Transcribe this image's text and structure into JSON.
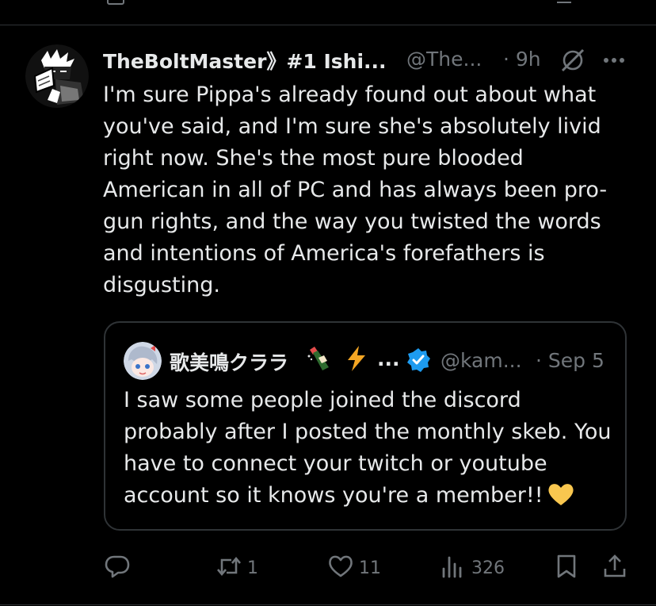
{
  "tweet": {
    "author_name": "TheBoltMaster》#1 Ishi...",
    "author_handle": "@The...",
    "time": "· 9h",
    "text": "I'm sure Pippa's already found out about what you've said, and I'm sure she's absolutely livid right now. She's the most pure blooded American in all of PC and has always been pro-gun rights, and the way you twisted the words and intentions of America's forefathers is disgusting."
  },
  "quote": {
    "author_name": "歌美鳴クララ",
    "ellipsis": "...",
    "author_handle": "@kam...",
    "time": "· Sep 5",
    "text": "I saw some people joined the discord probably after I posted the monthly skeb. You have to connect your twitch or youtube account so it knows you're a member!!"
  },
  "actions": {
    "replies": "",
    "retweets": "1",
    "likes": "11",
    "views": "326"
  },
  "icons": {
    "grok": "grok-icon",
    "more": "more-icon",
    "verified": "verified-badge-icon",
    "reply": "reply-icon",
    "retweet": "retweet-icon",
    "like": "heart-icon",
    "views": "views-icon",
    "bookmark": "bookmark-icon",
    "share": "share-icon"
  },
  "colors": {
    "background": "#000000",
    "text": "#e7e9ea",
    "secondary_text": "#71767b",
    "border": "#2f3336",
    "verified": "#1d9bf0",
    "heart_emoji": "#f9c74f"
  }
}
